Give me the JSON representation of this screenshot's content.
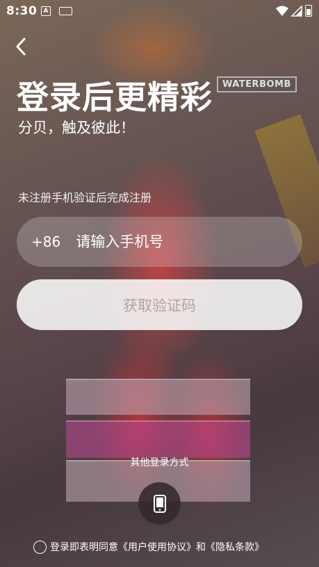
{
  "status_bar": {
    "time": "8:30",
    "notification_icon": "A",
    "icons": [
      "app-notification-icon",
      "keyboard-icon",
      "wifi-icon",
      "signal-icon",
      "battery-icon"
    ]
  },
  "background": {
    "watermark_text": "WATERBOMB"
  },
  "header": {
    "back_icon": "chevron-left-icon",
    "title": "登录后更精彩",
    "subtitle": "分贝，触及彼此！"
  },
  "form": {
    "hint": "未注册手机验证后完成注册",
    "country_code": "+86",
    "phone_placeholder": "请输入手机号",
    "phone_value": "",
    "get_code_label": "获取验证码"
  },
  "other_login": {
    "label": "其他登录方式",
    "phone_icon": "mobile-phone-icon"
  },
  "agreement": {
    "checked": false,
    "prefix": "登录即表明同意",
    "user_agreement": "《用户使用协议》",
    "conjunction": "和",
    "privacy_policy": "《隐私条款》"
  },
  "colors": {
    "input_bg": "rgba(255,255,255,0.22)",
    "button_bg": "rgba(255,255,255,0.85)",
    "button_text": "#a9a7a8",
    "phone_login_bg": "#32282d"
  }
}
